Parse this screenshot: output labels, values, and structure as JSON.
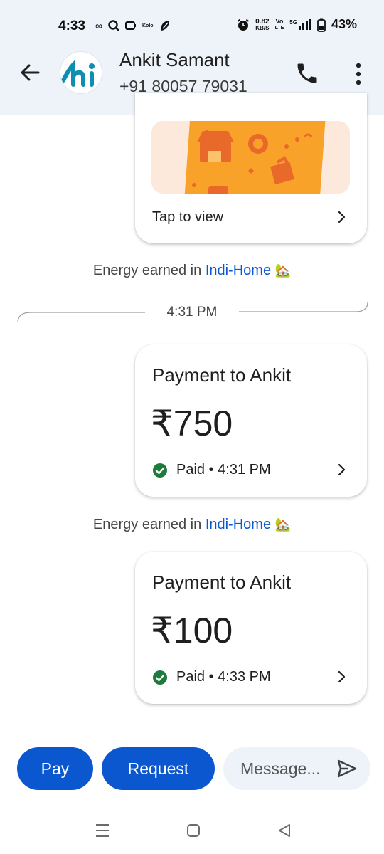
{
  "status_bar": {
    "time": "4:33",
    "small_label": "Kolo",
    "net_speed_value": "0.82",
    "net_speed_unit": "KB/S",
    "volte_top": "Vo",
    "volte_bottom": "LTE",
    "network": "5G",
    "battery": "43%"
  },
  "header": {
    "contact_name": "Ankit Samant",
    "contact_phone": "+91 80057 79031",
    "avatar_text": "hi",
    "accent": "#0b57d0"
  },
  "messages": {
    "promo_card": {
      "cta": "Tap to view"
    },
    "energy_1": {
      "prefix": "Energy earned in",
      "link": "Indi-Home",
      "emoji": "🏡"
    },
    "date_divider": "4:31 PM",
    "payment_1": {
      "title": "Payment to Ankit",
      "amount": "₹750",
      "status": "Paid • 4:31 PM"
    },
    "energy_2": {
      "prefix": "Energy earned in",
      "link": "Indi-Home",
      "emoji": "🏡"
    },
    "payment_2": {
      "title": "Payment to Ankit",
      "amount": "₹100",
      "status": "Paid • 4:33 PM"
    }
  },
  "composer": {
    "pay_label": "Pay",
    "request_label": "Request",
    "message_placeholder": "Message..."
  },
  "colors": {
    "header_bg": "#eef3fa",
    "primary_button": "#0b57d0",
    "paid_check": "#1e7b3b",
    "promo_orange": "#f9a22a"
  }
}
